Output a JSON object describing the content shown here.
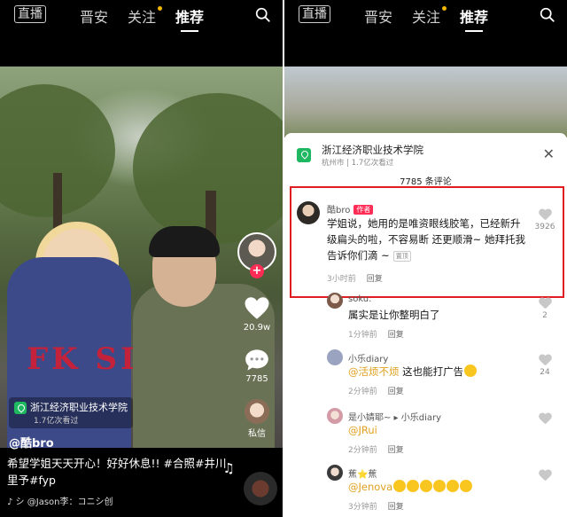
{
  "left": {
    "logo": "直播",
    "tabs": [
      {
        "label": "晋安",
        "active": false,
        "dot": false
      },
      {
        "label": "关注",
        "active": false,
        "dot": true
      },
      {
        "label": "推荐",
        "active": true,
        "dot": false
      }
    ],
    "shirt_text": "FK SI",
    "side": {
      "like_count": "20.9w",
      "comment_count": "7785",
      "message_label": "私信"
    },
    "location": {
      "name": "浙江经济职业技术学院",
      "views": "1.7亿次看过"
    },
    "author": "@酷bro",
    "caption": "希望学姐天天开心！好好休息!! #合照#井川里予#fyp",
    "music": "♪ シ   @Jason李：コニシ创"
  },
  "right": {
    "logo": "直播",
    "tabs": [
      {
        "label": "晋安",
        "active": false,
        "dot": false
      },
      {
        "label": "关注",
        "active": false,
        "dot": true
      },
      {
        "label": "推荐",
        "active": true,
        "dot": false
      }
    ],
    "sheet": {
      "location_name": "浙江经济职业技术学院",
      "location_sub": "杭州市 | 1.7亿次看过",
      "comment_count": "7785 条评论",
      "comments": [
        {
          "user": "酷bro",
          "badge": "作者",
          "text": "学姐说，她用的是唯资眼线胶笔，已经新升级扁头的啦，不容易断 还更顺滑~ 她拜托我告诉你们滴 ~",
          "top_label": "置顶",
          "time": "3小时前",
          "reply": "回复",
          "likes": "3926"
        },
        {
          "user": "soku.",
          "text": "属实是让你整明白了",
          "time": "1分钟前",
          "reply": "回复",
          "likes": "2"
        },
        {
          "user": "小乐diary",
          "mention": "@活烦不烦",
          "text": " 这也能打广告",
          "time": "2分钟前",
          "reply": "回复",
          "likes": "24"
        },
        {
          "user": "是小婧耶~ ▸ 小乐diary",
          "mention": "@JRui",
          "text": "",
          "time": "2分钟前",
          "reply": "回复",
          "likes": ""
        },
        {
          "user": "蕉⭐蕉",
          "mention": "@Jenova",
          "text": "",
          "time": "3分钟前",
          "reply": "回复",
          "likes": ""
        }
      ]
    }
  }
}
